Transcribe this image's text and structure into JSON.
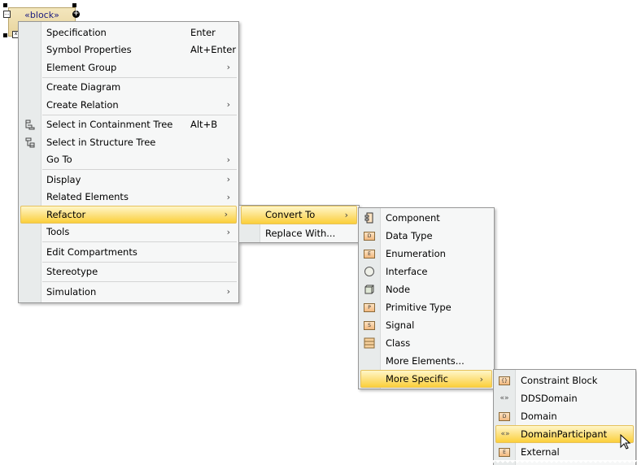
{
  "diagram": {
    "block_stereotype": "«block»"
  },
  "menus": [
    {
      "id": "context-menu",
      "items": [
        {
          "label": "Specification",
          "shortcut": "Enter"
        },
        {
          "label": "Symbol Properties",
          "shortcut": "Alt+Enter"
        },
        {
          "label": "Element Group",
          "submenu": true
        },
        {
          "sep": true
        },
        {
          "label": "Create Diagram"
        },
        {
          "label": "Create Relation",
          "submenu": true
        },
        {
          "sep": true
        },
        {
          "label": "Select in Containment Tree",
          "shortcut": "Alt+B",
          "icon": "containment-tree-icon"
        },
        {
          "label": "Select in Structure Tree",
          "icon": "structure-tree-icon"
        },
        {
          "label": "Go To",
          "submenu": true
        },
        {
          "sep": true
        },
        {
          "label": "Display",
          "submenu": true
        },
        {
          "label": "Related Elements",
          "submenu": true
        },
        {
          "label": "Refactor",
          "submenu": true,
          "highlighted": true
        },
        {
          "label": "Tools",
          "submenu": true
        },
        {
          "sep": true
        },
        {
          "label": "Edit Compartments"
        },
        {
          "sep": true
        },
        {
          "label": "Stereotype"
        },
        {
          "sep": true
        },
        {
          "label": "Simulation",
          "submenu": true
        }
      ]
    },
    {
      "id": "refactor-submenu",
      "items": [
        {
          "label": "Convert To",
          "submenu": true,
          "highlighted": true
        },
        {
          "label": "Replace With..."
        }
      ]
    },
    {
      "id": "convert-to-submenu",
      "items": [
        {
          "label": "Component",
          "icon": "component-icon"
        },
        {
          "label": "Data Type",
          "icon": "data-type-icon",
          "glyph": "D"
        },
        {
          "label": "Enumeration",
          "icon": "enumeration-icon",
          "glyph": "E"
        },
        {
          "label": "Interface",
          "icon": "interface-icon"
        },
        {
          "label": "Node",
          "icon": "node-icon"
        },
        {
          "label": "Primitive Type",
          "icon": "primitive-type-icon",
          "glyph": "P"
        },
        {
          "label": "Signal",
          "icon": "signal-icon",
          "glyph": "S"
        },
        {
          "label": "Class",
          "icon": "class-icon"
        },
        {
          "label": "More Elements..."
        },
        {
          "label": "More Specific",
          "submenu": true,
          "highlighted": true
        }
      ]
    },
    {
      "id": "more-specific-submenu",
      "items": [
        {
          "label": "Constraint Block",
          "icon": "constraint-block-icon",
          "glyph": "{}"
        },
        {
          "label": "DDSDomain",
          "icon": "stereotype-icon",
          "glyph": "«»"
        },
        {
          "label": "Domain",
          "icon": "domain-icon",
          "glyph": "D"
        },
        {
          "label": "DomainParticipant",
          "icon": "stereotype-icon",
          "glyph": "«»",
          "highlighted": true
        },
        {
          "label": "External",
          "icon": "external-icon",
          "glyph": "E"
        }
      ]
    }
  ]
}
